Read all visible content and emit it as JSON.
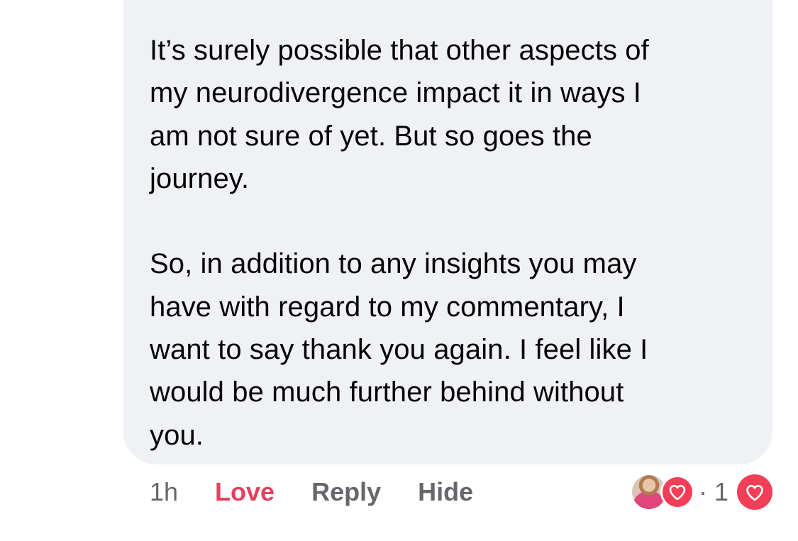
{
  "comment": {
    "paragraphs": [
      "It’s surely possible that other aspects of\nmy neurodivergence impact it in ways I\nam not sure of yet. But so goes the\njourney.",
      "So, in addition to any insights you may\nhave with regard to my commentary, I\nwant to say thank you again. I feel like I\nwould be much further behind without\nyou."
    ]
  },
  "actions": {
    "timestamp": "1h",
    "love_label": "Love",
    "reply_label": "Reply",
    "hide_label": "Hide"
  },
  "reactions": {
    "summary": "· 1",
    "icon": "heart-icon"
  },
  "colors": {
    "bubble": "#f0f1f5",
    "love_active": "#e4405f",
    "heart_badge": "#f33e58",
    "muted": "#65676b"
  }
}
